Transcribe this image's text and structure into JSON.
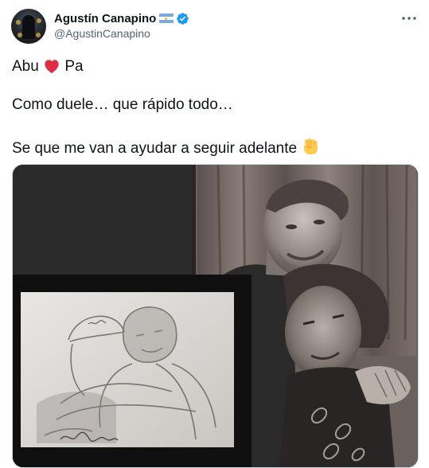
{
  "author": {
    "display_name": "Agustín Canapino",
    "handle": "@AgustinCanapino",
    "flag_icon": "argentina-flag-icon",
    "verified_icon": "verified-badge-icon"
  },
  "tweet": {
    "line1_part1": "Abu",
    "line1_emoji": "red-heart-icon",
    "line1_part2": "Pa",
    "line2": "Como duele… que rápido todo…",
    "line3": "Se que me van a ayudar a seguir adelante",
    "line3_emoji": "raised-fist-icon"
  },
  "media": {
    "description_icon": "photo-of-pencil-drawings"
  },
  "colors": {
    "text": "#0f1419",
    "secondary": "#536471",
    "verified": "#1d9bf0",
    "heart": "#e0245e"
  }
}
